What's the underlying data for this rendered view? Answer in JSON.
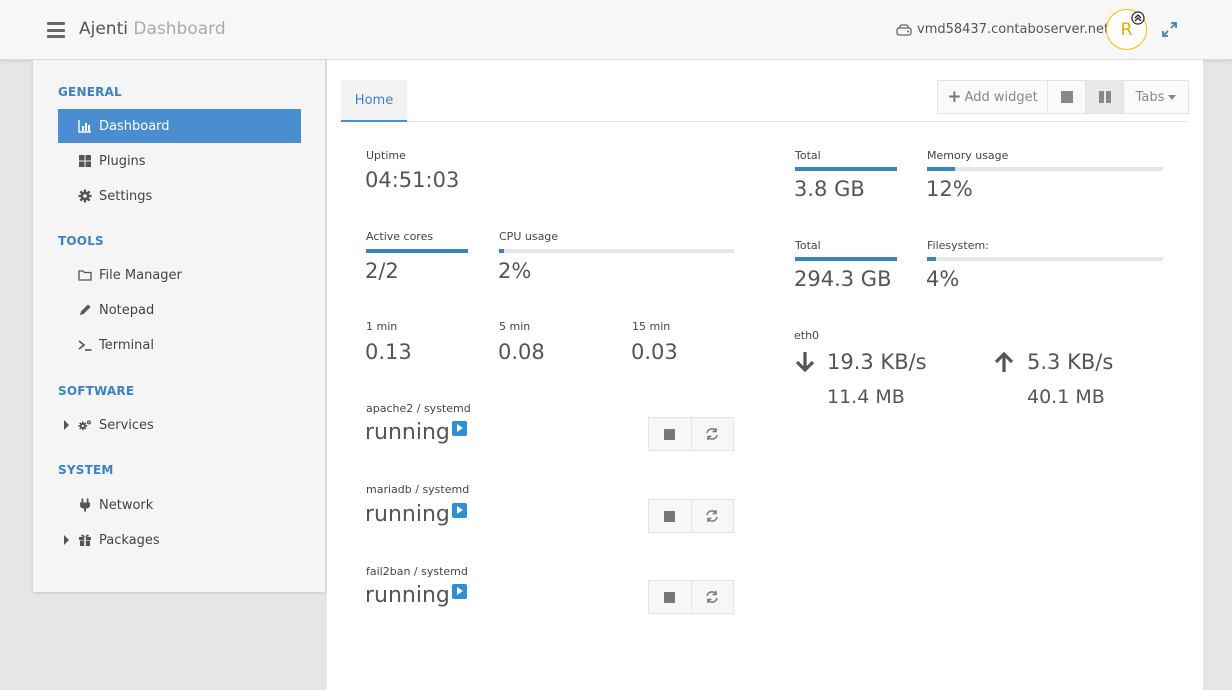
{
  "header": {
    "brand": "Ajenti",
    "brand_sub": "Dashboard",
    "hostname": "vmd58437.contaboserver.net",
    "avatar_letter": "R",
    "icons": [
      "menu-icon",
      "server-icon",
      "expand-icon",
      "upgrade-badge-icon"
    ]
  },
  "sidebar": {
    "sections": [
      {
        "title": "GENERAL",
        "items": [
          {
            "label": "Dashboard",
            "icon": "chart-icon",
            "active": true
          },
          {
            "label": "Plugins",
            "icon": "grid-icon"
          },
          {
            "label": "Settings",
            "icon": "gear-icon"
          }
        ]
      },
      {
        "title": "TOOLS",
        "items": [
          {
            "label": "File Manager",
            "icon": "folder-icon"
          },
          {
            "label": "Notepad",
            "icon": "pencil-icon"
          },
          {
            "label": "Terminal",
            "icon": "terminal-icon"
          }
        ]
      },
      {
        "title": "SOFTWARE",
        "items": [
          {
            "label": "Services",
            "icon": "gears-icon",
            "expandable": true
          }
        ]
      },
      {
        "title": "SYSTEM",
        "items": [
          {
            "label": "Network",
            "icon": "plug-icon"
          },
          {
            "label": "Packages",
            "icon": "gift-icon",
            "expandable": true
          }
        ]
      }
    ]
  },
  "main": {
    "tab_home": "Home",
    "toolbar": {
      "add_widget": "Add widget",
      "tabs": "Tabs"
    },
    "uptime": {
      "label": "Uptime",
      "value": "04:51:03"
    },
    "cores": {
      "label": "Active cores",
      "value": "2/2",
      "fill_percent": 100
    },
    "cpu": {
      "label": "CPU usage",
      "value": "2%",
      "fill_percent": 2
    },
    "load": [
      {
        "label": "1 min",
        "value": "0.13"
      },
      {
        "label": "5 min",
        "value": "0.08"
      },
      {
        "label": "15 min",
        "value": "0.03"
      }
    ],
    "services": [
      {
        "name": "apache2 / systemd",
        "state": "running"
      },
      {
        "name": "mariadb / systemd",
        "state": "running"
      },
      {
        "name": "fail2ban / systemd",
        "state": "running"
      }
    ],
    "memory_total": {
      "label": "Total",
      "value": "3.8 GB",
      "fill_percent": 100
    },
    "memory_usage": {
      "label": "Memory usage",
      "value": "12%",
      "fill_percent": 12
    },
    "fs_total": {
      "label": "Total",
      "value": "294.3 GB",
      "fill_percent": 100
    },
    "fs_usage": {
      "label": "Filesystem:",
      "value": "4%",
      "fill_percent": 4
    },
    "network": {
      "iface": "eth0",
      "down_rate": "19.3 KB/s",
      "down_total": "11.4 MB",
      "up_rate": "5.3 KB/s",
      "up_total": "40.1 MB"
    },
    "colors": {
      "accent": "#3a82c4",
      "active_nav": "#4a8dd1",
      "avatar": "#f0c000",
      "play": "#2f8fd6"
    }
  }
}
